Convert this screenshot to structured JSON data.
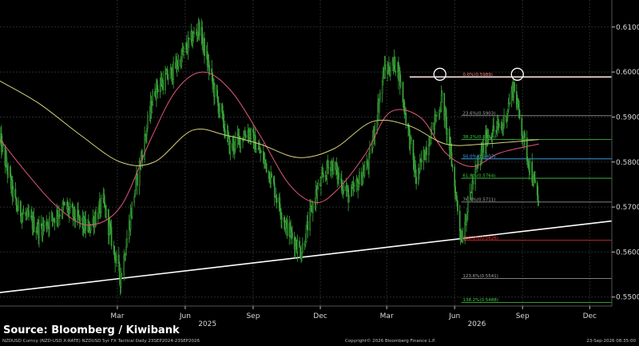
{
  "chart_data": {
    "type": "candlestick",
    "grid": true,
    "y_axis": {
      "position": "right",
      "ylim": [
        0.548,
        0.616
      ],
      "ticks": [
        "0.6100",
        "0.6000",
        "0.5900",
        "0.5800",
        "0.5700",
        "0.5600",
        "0.5500"
      ]
    },
    "x_axis": {
      "month_labels": [
        "Mar",
        "Jun",
        "Sep",
        "Dec",
        "Mar",
        "Jun",
        "Sep",
        "Dec"
      ],
      "year_labels": [
        "2025",
        "2026"
      ]
    },
    "price_path": [
      {
        "x": "2024-09-23",
        "y": 0.585
      },
      {
        "x": "2024-10-15",
        "y": 0.57
      },
      {
        "x": "2024-11-15",
        "y": 0.565
      },
      {
        "x": "2024-12-20",
        "y": 0.57
      },
      {
        "x": "2025-01-20",
        "y": 0.565
      },
      {
        "x": "2025-02-10",
        "y": 0.571
      },
      {
        "x": "2025-03-05",
        "y": 0.554
      },
      {
        "x": "2025-03-25",
        "y": 0.574
      },
      {
        "x": "2025-04-20",
        "y": 0.596
      },
      {
        "x": "2025-05-15",
        "y": 0.6
      },
      {
        "x": "2025-06-05",
        "y": 0.606
      },
      {
        "x": "2025-06-20",
        "y": 0.61
      },
      {
        "x": "2025-07-10",
        "y": 0.596
      },
      {
        "x": "2025-08-01",
        "y": 0.583
      },
      {
        "x": "2025-08-25",
        "y": 0.587
      },
      {
        "x": "2025-09-20",
        "y": 0.579
      },
      {
        "x": "2025-10-15",
        "y": 0.566
      },
      {
        "x": "2025-11-05",
        "y": 0.56
      },
      {
        "x": "2025-11-25",
        "y": 0.573
      },
      {
        "x": "2025-12-15",
        "y": 0.58
      },
      {
        "x": "2026-01-10",
        "y": 0.572
      },
      {
        "x": "2026-02-05",
        "y": 0.58
      },
      {
        "x": "2026-02-25",
        "y": 0.6
      },
      {
        "x": "2026-03-15",
        "y": 0.602
      },
      {
        "x": "2026-04-10",
        "y": 0.576
      },
      {
        "x": "2026-04-25",
        "y": 0.584
      },
      {
        "x": "2026-05-15",
        "y": 0.594
      },
      {
        "x": "2026-05-28",
        "y": 0.58
      },
      {
        "x": "2026-06-10",
        "y": 0.563
      },
      {
        "x": "2026-06-25",
        "y": 0.575
      },
      {
        "x": "2026-07-15",
        "y": 0.586
      },
      {
        "x": "2026-08-05",
        "y": 0.588
      },
      {
        "x": "2026-08-20",
        "y": 0.597
      },
      {
        "x": "2026-09-05",
        "y": 0.583
      },
      {
        "x": "2026-09-23",
        "y": 0.571
      }
    ],
    "series": [
      {
        "color": "#e05878",
        "points": [
          {
            "x": "2024-09-23",
            "y": 0.585
          },
          {
            "x": "2024-11-01",
            "y": 0.577
          },
          {
            "x": "2024-12-10",
            "y": 0.57
          },
          {
            "x": "2025-01-20",
            "y": 0.566
          },
          {
            "x": "2025-03-05",
            "y": 0.57
          },
          {
            "x": "2025-04-15",
            "y": 0.585
          },
          {
            "x": "2025-05-20",
            "y": 0.596
          },
          {
            "x": "2025-06-25",
            "y": 0.6
          },
          {
            "x": "2025-08-01",
            "y": 0.596
          },
          {
            "x": "2025-09-10",
            "y": 0.586
          },
          {
            "x": "2025-10-20",
            "y": 0.575
          },
          {
            "x": "2025-11-25",
            "y": 0.571
          },
          {
            "x": "2025-12-25",
            "y": 0.574
          },
          {
            "x": "2026-02-01",
            "y": 0.582
          },
          {
            "x": "2026-03-05",
            "y": 0.591
          },
          {
            "x": "2026-04-15",
            "y": 0.59
          },
          {
            "x": "2026-05-20",
            "y": 0.582
          },
          {
            "x": "2026-06-25",
            "y": 0.579
          },
          {
            "x": "2026-08-01",
            "y": 0.582
          },
          {
            "x": "2026-09-23",
            "y": 0.584
          }
        ]
      },
      {
        "color": "#d6d27a",
        "points": [
          {
            "x": "2024-09-23",
            "y": 0.598
          },
          {
            "x": "2024-11-15",
            "y": 0.593
          },
          {
            "x": "2025-01-10",
            "y": 0.586
          },
          {
            "x": "2025-03-05",
            "y": 0.58
          },
          {
            "x": "2025-04-20",
            "y": 0.58
          },
          {
            "x": "2025-06-10",
            "y": 0.587
          },
          {
            "x": "2025-07-25",
            "y": 0.586
          },
          {
            "x": "2025-09-10",
            "y": 0.584
          },
          {
            "x": "2025-11-01",
            "y": 0.581
          },
          {
            "x": "2025-12-20",
            "y": 0.583
          },
          {
            "x": "2026-02-10",
            "y": 0.589
          },
          {
            "x": "2026-04-01",
            "y": 0.588
          },
          {
            "x": "2026-05-20",
            "y": 0.584
          },
          {
            "x": "2026-07-10",
            "y": 0.584
          },
          {
            "x": "2026-09-23",
            "y": 0.585
          }
        ]
      }
    ],
    "trendline": {
      "color": "#ffffff",
      "points": [
        {
          "x": "2024-09-23",
          "y": 0.551
        },
        {
          "x": "2026-12-31",
          "y": 0.5669
        }
      ]
    },
    "peak_markers": [
      {
        "x": "2026-05-12",
        "y": 0.5995
      },
      {
        "x": "2026-08-25",
        "y": 0.5995
      }
    ],
    "fib_levels": [
      {
        "label": "0.0%(0.5989)",
        "value": 0.5989,
        "color": "#ff8080",
        "strong": true
      },
      {
        "label": "23.6%(0.5903)",
        "value": 0.5903,
        "color": "#a8a8a8",
        "strong": false
      },
      {
        "label": "38.2%(0.5850)",
        "value": 0.585,
        "color": "#40d040",
        "strong": false
      },
      {
        "label": "50.0%(0.5807)",
        "value": 0.5807,
        "color": "#40b0ff",
        "strong": false
      },
      {
        "label": "61.8%(0.5764)",
        "value": 0.5764,
        "color": "#40d040",
        "strong": false
      },
      {
        "label": "76.4%(0.5711)",
        "value": 0.5711,
        "color": "#a8a8a8",
        "strong": false
      },
      {
        "label": "100.0%(0.5626)",
        "value": 0.5626,
        "color": "#ff3030",
        "strong": false
      },
      {
        "label": "123.6%(0.5541)",
        "value": 0.5541,
        "color": "#a8a8a8",
        "strong": false
      },
      {
        "label": "138.2%(0.5488)",
        "value": 0.5488,
        "color": "#40d040",
        "strong": false
      }
    ],
    "colors": {
      "candles": "#3aa63a",
      "grid": "#2a2a2a",
      "axis_text": "#d8d8d8"
    }
  },
  "source": "Source: Bloomberg / Kiwibank",
  "footer": {
    "left": "NZDUSD Curncy (NZD-USD X-RATE) NZDUSD 5yr FX Tactical Daily 23SEP2024-23SEP2026",
    "center": "Copyright© 2026 Bloomberg Finance L.P.",
    "right": "23-Sep-2026 08:35:00"
  }
}
